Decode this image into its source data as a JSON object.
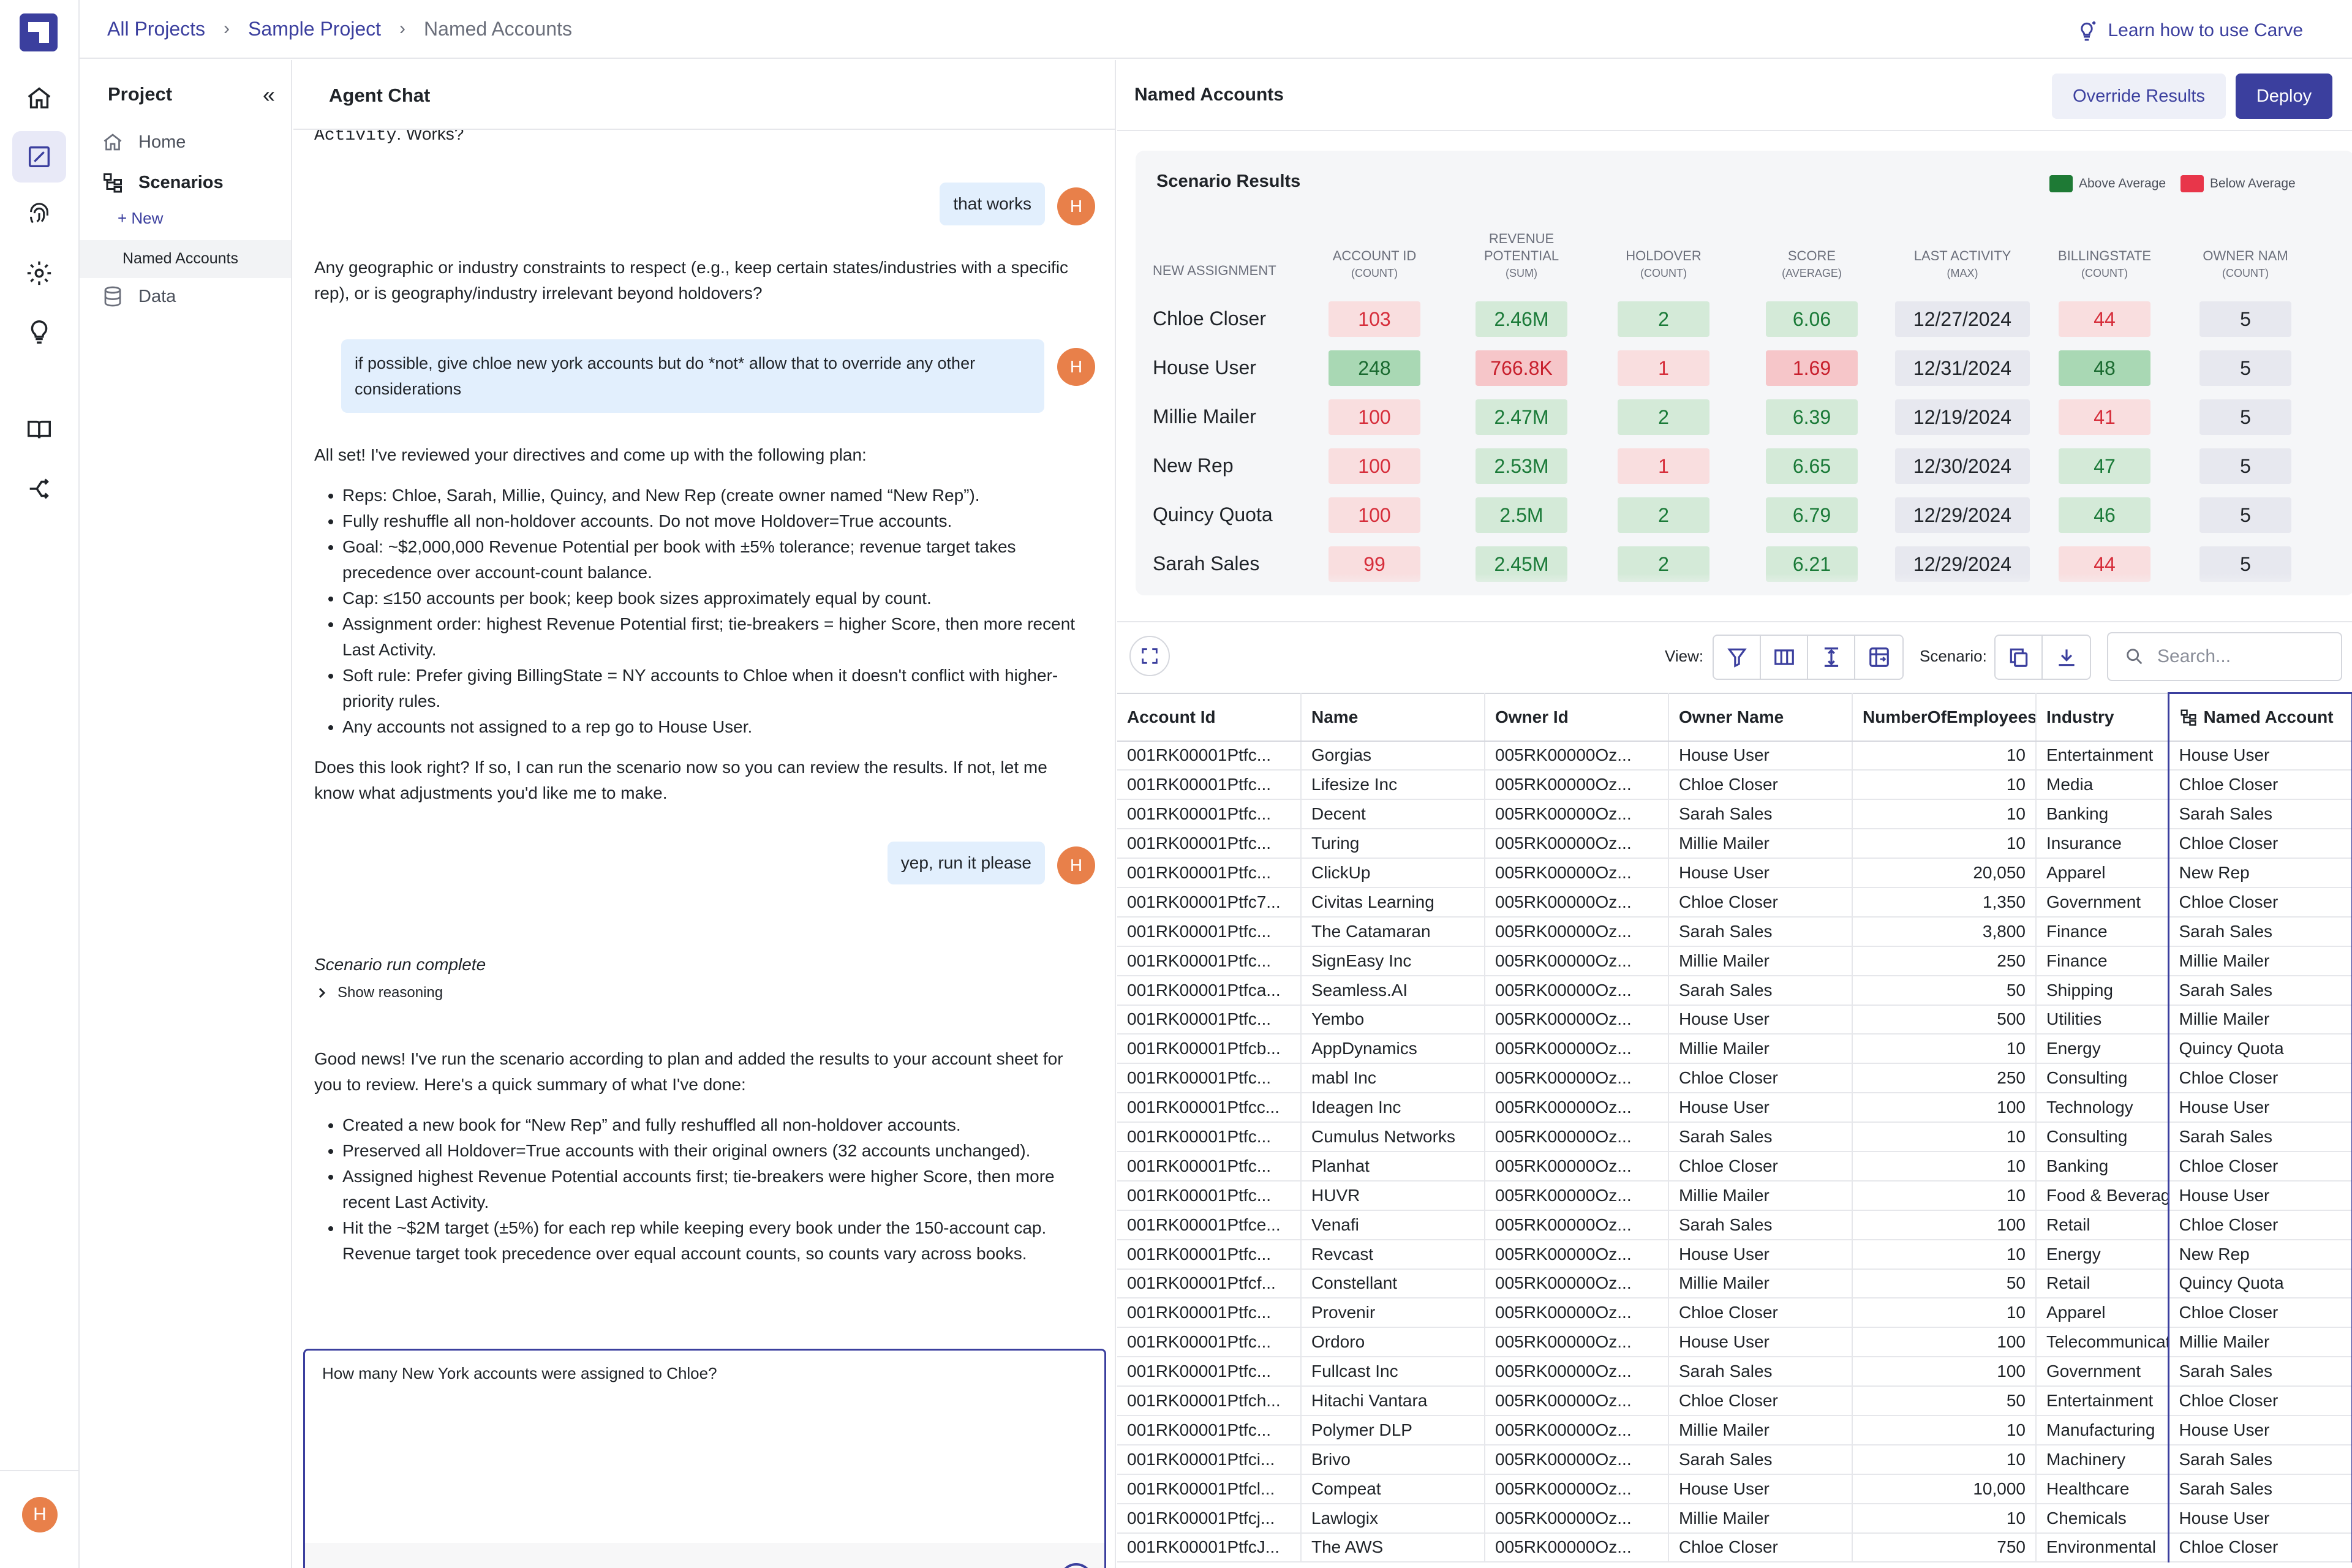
{
  "breadcrumb": {
    "items": [
      "All Projects",
      "Sample Project",
      "Named Accounts"
    ]
  },
  "learn_link": "Learn how to use Carve",
  "rail": {
    "icons": [
      "home-icon",
      "edit-square-icon",
      "fingerprint-icon",
      "gear-icon",
      "lightbulb-icon",
      "book-icon",
      "share-icon"
    ],
    "avatar": "H"
  },
  "project": {
    "title": "Project",
    "nav": [
      {
        "label": "Home",
        "icon": "home-icon"
      },
      {
        "label": "Scenarios",
        "icon": "hierarchy-icon"
      },
      {
        "label": "Data",
        "icon": "database-icon"
      }
    ],
    "new_label": "+ New",
    "selected_scenario": "Named Accounts"
  },
  "chat": {
    "title": "Agent Chat",
    "top_text_mono": "Activity",
    "top_text_rest": ". Works?",
    "messages": {
      "u1": "that works",
      "a1": "Any geographic or industry constraints to respect (e.g., keep certain states/industries with a specific rep), or is geography/industry irrelevant beyond holdovers?",
      "u2": "if possible, give chloe new york accounts but do *not* allow that to override any other considerations",
      "a2_intro": "All set! I've reviewed your directives and come up with the following plan:",
      "a2_bullets": [
        "Reps: Chloe, Sarah, Millie, Quincy, and New Rep (create owner named “New Rep”).",
        "Fully reshuffle all non-holdover accounts. Do not move Holdover=True accounts.",
        "Goal: ~$2,000,000 Revenue Potential per book with ±5% tolerance; revenue target takes precedence over account-count balance.",
        "Cap: ≤150 accounts per book; keep book sizes approximately equal by count.",
        "Assignment order: highest Revenue Potential first; tie-breakers = higher Score, then more recent Last Activity.",
        "Soft rule: Prefer giving BillingState = NY accounts to Chloe when it doesn't conflict with higher-priority rules.",
        "Any accounts not assigned to a rep go to House User."
      ],
      "a2_outro": "Does this look right? If so, I can run the scenario now so you can review the results. If not, let me know what adjustments you'd like me to make.",
      "u3": "yep, run it please",
      "run_status": "Scenario run complete",
      "show_reasoning": "Show reasoning",
      "a3_intro": "Good news! I've run the scenario according to plan and added the results to your account sheet for you to review. Here's a quick summary of what I've done:",
      "a3_bullets": [
        "Created a new book for “New Rep” and fully reshuffled all non-holdover accounts.",
        "Preserved all Holdover=True accounts with their original owners (32 accounts unchanged).",
        "Assigned highest Revenue Potential accounts first; tie-breakers were higher Score, then more recent Last Activity.",
        "Hit the ~$2M target (±5%) for each rep while keeping every book under the 150-account cap. Revenue target took precedence over equal account counts, so counts vary across books."
      ]
    },
    "user_avatar": "H",
    "input_value": "How many New York accounts were assigned to Chloe?"
  },
  "named_accounts": {
    "title": "Named Accounts",
    "override_button": "Override Results",
    "deploy_button": "Deploy",
    "scenario_results": {
      "title": "Scenario Results",
      "legend": [
        {
          "label": "Above Average",
          "color": "#1e7a35"
        },
        {
          "label": "Below Average",
          "color": "#e8364a"
        }
      ],
      "row_header": "NEW ASSIGNMENT",
      "columns": [
        {
          "name": "ACCOUNT ID",
          "agg": "(COUNT)"
        },
        {
          "name": "REVENUE POTENTIAL",
          "agg": "(SUM)"
        },
        {
          "name": "HOLDOVER",
          "agg": "(COUNT)"
        },
        {
          "name": "SCORE",
          "agg": "(AVERAGE)"
        },
        {
          "name": "LAST ACTIVITY",
          "agg": "(MAX)"
        },
        {
          "name": "BILLINGSTATE",
          "agg": "(COUNT)"
        },
        {
          "name": "OWNER NAM",
          "agg": "(COUNT)"
        }
      ],
      "rows": [
        {
          "name": "Chloe Closer",
          "cells": [
            {
              "v": "103",
              "s": "red"
            },
            {
              "v": "2.46M",
              "s": "green"
            },
            {
              "v": "2",
              "s": "green"
            },
            {
              "v": "6.06",
              "s": "green"
            },
            {
              "v": "12/27/2024",
              "s": "gray"
            },
            {
              "v": "44",
              "s": "red"
            },
            {
              "v": "5",
              "s": "gray"
            }
          ]
        },
        {
          "name": "House User",
          "cells": [
            {
              "v": "248",
              "s": "green2"
            },
            {
              "v": "766.8K",
              "s": "red2"
            },
            {
              "v": "1",
              "s": "red"
            },
            {
              "v": "1.69",
              "s": "red2"
            },
            {
              "v": "12/31/2024",
              "s": "gray"
            },
            {
              "v": "48",
              "s": "green2"
            },
            {
              "v": "5",
              "s": "gray"
            }
          ]
        },
        {
          "name": "Millie Mailer",
          "cells": [
            {
              "v": "100",
              "s": "red"
            },
            {
              "v": "2.47M",
              "s": "green"
            },
            {
              "v": "2",
              "s": "green"
            },
            {
              "v": "6.39",
              "s": "green"
            },
            {
              "v": "12/19/2024",
              "s": "gray"
            },
            {
              "v": "41",
              "s": "red"
            },
            {
              "v": "5",
              "s": "gray"
            }
          ]
        },
        {
          "name": "New Rep",
          "cells": [
            {
              "v": "100",
              "s": "red"
            },
            {
              "v": "2.53M",
              "s": "green"
            },
            {
              "v": "1",
              "s": "red"
            },
            {
              "v": "6.65",
              "s": "green"
            },
            {
              "v": "12/30/2024",
              "s": "gray"
            },
            {
              "v": "47",
              "s": "green"
            },
            {
              "v": "5",
              "s": "gray"
            }
          ]
        },
        {
          "name": "Quincy Quota",
          "cells": [
            {
              "v": "100",
              "s": "red"
            },
            {
              "v": "2.5M",
              "s": "green"
            },
            {
              "v": "2",
              "s": "green"
            },
            {
              "v": "6.79",
              "s": "green"
            },
            {
              "v": "12/29/2024",
              "s": "gray"
            },
            {
              "v": "46",
              "s": "green"
            },
            {
              "v": "5",
              "s": "gray"
            }
          ]
        },
        {
          "name": "Sarah Sales",
          "cells": [
            {
              "v": "99",
              "s": "red"
            },
            {
              "v": "2.45M",
              "s": "green"
            },
            {
              "v": "2",
              "s": "green"
            },
            {
              "v": "6.21",
              "s": "green"
            },
            {
              "v": "12/29/2024",
              "s": "gray"
            },
            {
              "v": "44",
              "s": "red"
            },
            {
              "v": "5",
              "s": "gray"
            }
          ]
        }
      ]
    },
    "toolbar": {
      "view_label": "View:",
      "view_icons": [
        "filter-icon",
        "columns-icon",
        "row-height-icon",
        "pivot-icon"
      ],
      "scenario_label": "Scenario:",
      "scenario_icons": [
        "copy-icon",
        "download-icon"
      ],
      "search_placeholder": "Search..."
    },
    "table": {
      "headers": [
        "Account Id",
        "Name",
        "Owner Id",
        "Owner Name",
        "NumberOfEmployees",
        "Industry",
        "Named Account"
      ],
      "rows": [
        [
          "001RK00001Ptfc...",
          "Gorgias",
          "005RK00000Oz...",
          "House User",
          "10",
          "Entertainment",
          "House User"
        ],
        [
          "001RK00001Ptfc...",
          "Lifesize Inc",
          "005RK00000Oz...",
          "Chloe Closer",
          "10",
          "Media",
          "Chloe Closer"
        ],
        [
          "001RK00001Ptfc...",
          "Decent",
          "005RK00000Oz...",
          "Sarah Sales",
          "10",
          "Banking",
          "Sarah Sales"
        ],
        [
          "001RK00001Ptfc...",
          "Turing",
          "005RK00000Oz...",
          "Millie Mailer",
          "10",
          "Insurance",
          "Chloe Closer"
        ],
        [
          "001RK00001Ptfc...",
          "ClickUp",
          "005RK00000Oz...",
          "House User",
          "20,050",
          "Apparel",
          "New Rep"
        ],
        [
          "001RK00001Ptfc7...",
          "Civitas Learning",
          "005RK00000Oz...",
          "Chloe Closer",
          "1,350",
          "Government",
          "Chloe Closer"
        ],
        [
          "001RK00001Ptfc...",
          "The Catamaran",
          "005RK00000Oz...",
          "Sarah Sales",
          "3,800",
          "Finance",
          "Sarah Sales"
        ],
        [
          "001RK00001Ptfc...",
          "SignEasy Inc",
          "005RK00000Oz...",
          "Millie Mailer",
          "250",
          "Finance",
          "Millie Mailer"
        ],
        [
          "001RK00001Ptfca...",
          "Seamless.AI",
          "005RK00000Oz...",
          "Sarah Sales",
          "50",
          "Shipping",
          "Sarah Sales"
        ],
        [
          "001RK00001Ptfc...",
          "Yembo",
          "005RK00000Oz...",
          "House User",
          "500",
          "Utilities",
          "Millie Mailer"
        ],
        [
          "001RK00001Ptfcb...",
          "AppDynamics",
          "005RK00000Oz...",
          "Millie Mailer",
          "10",
          "Energy",
          "Quincy Quota"
        ],
        [
          "001RK00001Ptfc...",
          "mabl Inc",
          "005RK00000Oz...",
          "Chloe Closer",
          "250",
          "Consulting",
          "Chloe Closer"
        ],
        [
          "001RK00001Ptfcc...",
          "Ideagen Inc",
          "005RK00000Oz...",
          "House User",
          "100",
          "Technology",
          "House User"
        ],
        [
          "001RK00001Ptfc...",
          "Cumulus Networks",
          "005RK00000Oz...",
          "Sarah Sales",
          "10",
          "Consulting",
          "Sarah Sales"
        ],
        [
          "001RK00001Ptfc...",
          "Planhat",
          "005RK00000Oz...",
          "Chloe Closer",
          "10",
          "Banking",
          "Chloe Closer"
        ],
        [
          "001RK00001Ptfc...",
          "HUVR",
          "005RK00000Oz...",
          "Millie Mailer",
          "10",
          "Food & Beverage",
          "House User"
        ],
        [
          "001RK00001Ptfce...",
          "Venafi",
          "005RK00000Oz...",
          "Sarah Sales",
          "100",
          "Retail",
          "Chloe Closer"
        ],
        [
          "001RK00001Ptfc...",
          "Revcast",
          "005RK00000Oz...",
          "House User",
          "10",
          "Energy",
          "New Rep"
        ],
        [
          "001RK00001Ptfcf...",
          "Constellant",
          "005RK00000Oz...",
          "Millie Mailer",
          "50",
          "Retail",
          "Quincy Quota"
        ],
        [
          "001RK00001Ptfc...",
          "Provenir",
          "005RK00000Oz...",
          "Chloe Closer",
          "10",
          "Apparel",
          "Chloe Closer"
        ],
        [
          "001RK00001Ptfc...",
          "Ordoro",
          "005RK00000Oz...",
          "House User",
          "100",
          "Telecommunications",
          "Millie Mailer"
        ],
        [
          "001RK00001Ptfc...",
          "Fullcast Inc",
          "005RK00000Oz...",
          "Sarah Sales",
          "100",
          "Government",
          "Sarah Sales"
        ],
        [
          "001RK00001Ptfch...",
          "Hitachi Vantara",
          "005RK00000Oz...",
          "Chloe Closer",
          "50",
          "Entertainment",
          "Chloe Closer"
        ],
        [
          "001RK00001Ptfc...",
          "Polymer DLP",
          "005RK00000Oz...",
          "Millie Mailer",
          "10",
          "Manufacturing",
          "House User"
        ],
        [
          "001RK00001Ptfci...",
          "Brivo",
          "005RK00000Oz...",
          "Sarah Sales",
          "10",
          "Machinery",
          "Sarah Sales"
        ],
        [
          "001RK00001Ptfcl...",
          "Compeat",
          "005RK00000Oz...",
          "House User",
          "10,000",
          "Healthcare",
          "Sarah Sales"
        ],
        [
          "001RK00001Ptfcj...",
          "Lawlogix",
          "005RK00000Oz...",
          "Millie Mailer",
          "10",
          "Chemicals",
          "House User"
        ],
        [
          "001RK00001PtfcJ...",
          "The AWS",
          "005RK00000Oz...",
          "Chloe Closer",
          "750",
          "Environmental",
          "Chloe Closer"
        ]
      ]
    }
  }
}
